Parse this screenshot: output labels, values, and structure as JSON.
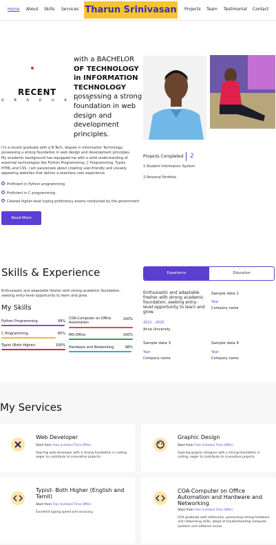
{
  "nav": {
    "left": [
      "Home",
      "About",
      "Skills",
      "Services"
    ],
    "brand": "Tharun Srinivasan",
    "right": [
      "Projects",
      "Team",
      "Testimonial",
      "Contact"
    ]
  },
  "hero": {
    "recent": "RECENT",
    "graduate": "G R A D U A T E",
    "headline_lines": [
      "with a BACHELOR",
      "OF TECHNOLOGY",
      "in INFORMATION",
      "TECHNOLOGY",
      "possessing a strong",
      "foundation in web",
      "design and",
      "development",
      "principles."
    ],
    "intro": "I'm a recent graduate with a B.Tech. degree in Information Technology, possessing a strong foundation in web design and development principles. My academic background has equipped me with a solid understanding of essential technologies like Python Programming, C Programming, Typist, HTML and CSS. I am passionate about creating user-friendly and visually appealing websites that deliver a seamless user experience.",
    "bullets": [
      "Proficient in Python programming",
      "Proficient in C programming",
      "Cleared higher-level typing proficiency exams conducted by the government."
    ],
    "read_more": "Read More",
    "projects_label": "Projects Completed",
    "projects_count": "2",
    "projects": [
      "1.Student Information System",
      "2.Personal Portfolio"
    ]
  },
  "skills": {
    "title": "Skills & Experience",
    "intro": "Enthusiastic and adaptable fresher with strong academic foundation, seeking entry-level opportunity to learn and grow.",
    "my_skills": "My Skills",
    "items": [
      {
        "label": "Python Programming",
        "pct": "99%",
        "color": "#7b4fd0",
        "fill": 0.99
      },
      {
        "label": "COA-Computer on Office Automation",
        "pct": "100%",
        "color": "#e04a4a",
        "fill": 1.0
      },
      {
        "label": "C Programming",
        "pct": "85%",
        "color": "#f2b632",
        "fill": 0.85
      },
      {
        "label": "MS-Office",
        "pct": "100%",
        "color": "#2e9c5a",
        "fill": 1.0
      },
      {
        "label": "Typist (Both Higher)",
        "pct": "100%",
        "color": "#c0392b",
        "fill": 1.0
      },
      {
        "label": "Hardware and Networking",
        "pct": "98%",
        "color": "#27b0d6",
        "fill": 0.98
      }
    ],
    "tabs": {
      "experience": "Experience",
      "education": "Education"
    },
    "exp_text": "Enthusiastic and adaptable fresher with strong academic foundation, seeking entry-level opportunity to learn and grow.",
    "exp_date": "2021 - 2025",
    "exp_company": "Anna University",
    "samples": [
      {
        "title": "Sample data 2",
        "year": "Year",
        "company": "Company name"
      },
      {
        "title": "Sample data 3",
        "year": "Year",
        "company": "Company name"
      },
      {
        "title": "Sample data 4",
        "year": "Year",
        "company": "Company name"
      }
    ]
  },
  "services": {
    "title": "My Services",
    "start_label": "Start from",
    "start_value": "Free (Limited Time Offer)",
    "cards": [
      {
        "title": "Web Developer",
        "desc": "Aspiring web developer with a strong foundation in coding, eager to contribute to innovative projects.",
        "icon": "brush-icon"
      },
      {
        "title": "Graphic Design",
        "desc": "Aspiring graphic designer with a strong foundation in coding, eager to contribute to innovative projects.",
        "icon": "palette-icon"
      },
      {
        "title": "Typist- Both Higher (English and Tamil)",
        "desc": "Excellent typing speed and accuracy.",
        "icon": "code-icon"
      },
      {
        "title": "COA-Computer on Office Automation and Hardware and Networking",
        "desc": "COA graduate with distinction, possessing strong hardware and networking skills, adept at troubleshooting computer systems and software issues.",
        "icon": "code-icon"
      }
    ]
  }
}
